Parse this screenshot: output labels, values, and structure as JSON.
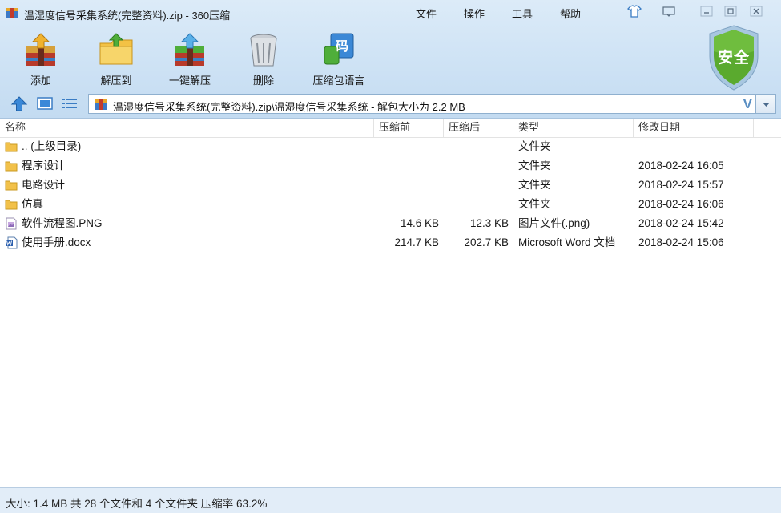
{
  "window": {
    "title": "温湿度信号采集系统(完整资料).zip - 360压缩",
    "menu": [
      "文件",
      "操作",
      "工具",
      "帮助"
    ]
  },
  "toolbar": {
    "buttons": [
      {
        "label": "添加",
        "icon": "add-archive-icon"
      },
      {
        "label": "解压到",
        "icon": "extract-to-icon"
      },
      {
        "label": "一键解压",
        "icon": "one-click-extract-icon"
      },
      {
        "label": "删除",
        "icon": "delete-trash-icon"
      },
      {
        "label": "压缩包语言",
        "icon": "archive-language-icon",
        "glyph": "码"
      }
    ],
    "security_badge": "安全"
  },
  "address": {
    "path": "温湿度信号采集系统(完整资料).zip\\温湿度信号采集系统 - 解包大小为 2.2 MB",
    "dropdown_glyph": "V"
  },
  "table": {
    "columns": [
      "名称",
      "压缩前",
      "压缩后",
      "类型",
      "修改日期"
    ],
    "rows": [
      {
        "name": ".. (上级目录)",
        "icon": "folder-icon",
        "before": "",
        "after": "",
        "type": "文件夹",
        "date": ""
      },
      {
        "name": "程序设计",
        "icon": "folder-icon",
        "before": "",
        "after": "",
        "type": "文件夹",
        "date": "2018-02-24 16:05"
      },
      {
        "name": "电路设计",
        "icon": "folder-icon",
        "before": "",
        "after": "",
        "type": "文件夹",
        "date": "2018-02-24 15:57"
      },
      {
        "name": "仿真",
        "icon": "folder-icon",
        "before": "",
        "after": "",
        "type": "文件夹",
        "date": "2018-02-24 16:06"
      },
      {
        "name": "软件流程图.PNG",
        "icon": "png-file-icon",
        "before": "14.6 KB",
        "after": "12.3 KB",
        "type": "图片文件(.png)",
        "date": "2018-02-24 15:42"
      },
      {
        "name": "使用手册.docx",
        "icon": "word-file-icon",
        "before": "214.7 KB",
        "after": "202.7 KB",
        "type": "Microsoft Word 文档",
        "date": "2018-02-24 15:06"
      }
    ]
  },
  "status": {
    "text": "大小: 1.4 MB 共 28 个文件和 4 个文件夹 压缩率 63.2%"
  },
  "colors": {
    "toolbar_bg": "#cfe3f5",
    "accent": "#3a7cc4",
    "shield_green": "#4fa02a"
  }
}
